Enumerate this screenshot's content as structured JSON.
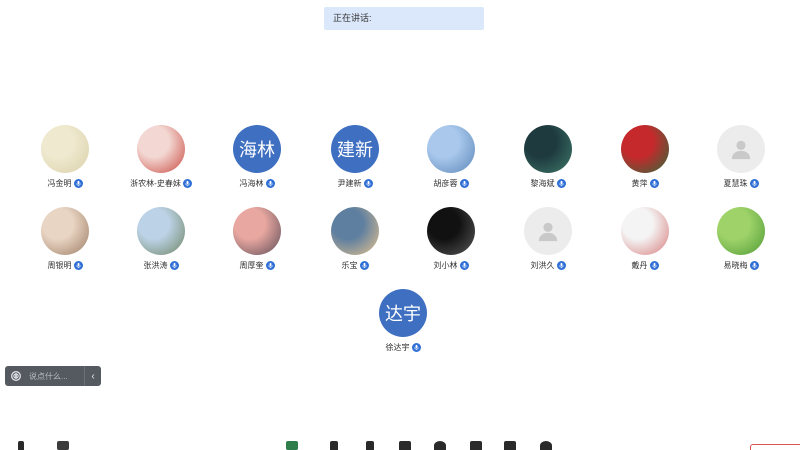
{
  "speaking_banner": {
    "label": "正在讲话:"
  },
  "participants": [
    {
      "name": "冯金明",
      "avatar_kind": "photo",
      "colors": [
        "#efe9cf",
        "#d9d0a9"
      ]
    },
    {
      "name": "浙农林-史春妹",
      "avatar_kind": "photo",
      "colors": [
        "#f3d7d2",
        "#c9473f"
      ]
    },
    {
      "name": "冯海林",
      "avatar_kind": "initials",
      "initials": "海林"
    },
    {
      "name": "尹建新",
      "avatar_kind": "initials",
      "initials": "建新"
    },
    {
      "name": "胡彦蓉",
      "avatar_kind": "photo",
      "colors": [
        "#a9c8ec",
        "#5b86b8"
      ]
    },
    {
      "name": "黎海斌",
      "avatar_kind": "photo",
      "colors": [
        "#1e3a3f",
        "#3f7a6a"
      ]
    },
    {
      "name": "黄萍",
      "avatar_kind": "photo",
      "colors": [
        "#c6292c",
        "#2e6b3a"
      ]
    },
    {
      "name": "夏慧珠",
      "avatar_kind": "placeholder"
    },
    {
      "name": "周银明",
      "avatar_kind": "photo",
      "colors": [
        "#e9d5c3",
        "#9b7b63"
      ]
    },
    {
      "name": "张洪涛",
      "avatar_kind": "photo",
      "colors": [
        "#bcd2e6",
        "#6d8462"
      ]
    },
    {
      "name": "周厚奎",
      "avatar_kind": "photo",
      "colors": [
        "#e8a7a0",
        "#5b4b56"
      ]
    },
    {
      "name": "乐宝",
      "avatar_kind": "photo",
      "colors": [
        "#5f7fa0",
        "#e8c48d"
      ]
    },
    {
      "name": "刘小林",
      "avatar_kind": "photo",
      "colors": [
        "#111111",
        "#5a5a5a"
      ]
    },
    {
      "name": "刘洪久",
      "avatar_kind": "placeholder"
    },
    {
      "name": "戴丹",
      "avatar_kind": "photo",
      "colors": [
        "#f4f4f4",
        "#d77a7a"
      ]
    },
    {
      "name": "易晓梅",
      "avatar_kind": "photo",
      "colors": [
        "#9fd36a",
        "#4f9a34"
      ]
    },
    {
      "name": "徐达宇",
      "avatar_kind": "initials",
      "initials": "达宇"
    }
  ],
  "chat": {
    "placeholder": "说点什么...",
    "collapse_glyph": "‹"
  },
  "icons": {
    "mic": "mic-icon",
    "chat": "chat-bubble-icon",
    "user_placeholder": "user-placeholder-icon"
  },
  "colors": {
    "accent": "#2f6fd6",
    "initials_bg": "#3f6fc1",
    "banner_bg": "#dbe8fb"
  }
}
